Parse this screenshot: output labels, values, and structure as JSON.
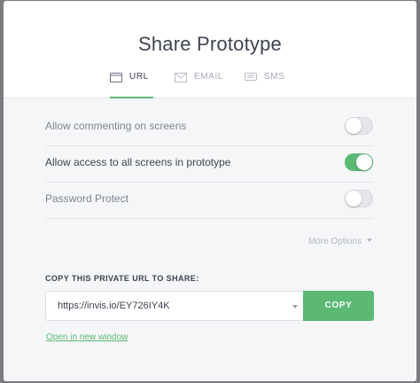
{
  "modal": {
    "title": "Share Prototype"
  },
  "tabs": [
    {
      "label": "URL",
      "icon": "browser-window-icon",
      "active": true
    },
    {
      "label": "EMAIL",
      "icon": "envelope-icon",
      "active": false
    },
    {
      "label": "SMS",
      "icon": "chat-bubble-icon",
      "active": false
    }
  ],
  "settings": [
    {
      "label": "Allow commenting on screens",
      "enabled": false
    },
    {
      "label": "Allow access to all screens in prototype",
      "enabled": true
    },
    {
      "label": "Password Protect",
      "enabled": false
    }
  ],
  "more_options": {
    "label": "More Options",
    "icon": "caret-down-icon"
  },
  "share": {
    "label": "COPY THIS PRIVATE URL TO SHARE:",
    "url": "https://invis.io/EY726IY4K",
    "copy_label": "COPY",
    "open_link": "Open in new window"
  },
  "colors": {
    "accent": "#5bb974",
    "text_dark": "#3d4350",
    "text_muted": "#7e8490",
    "panel_bg": "#f5f6f8",
    "backdrop": "#7a7b7e"
  }
}
